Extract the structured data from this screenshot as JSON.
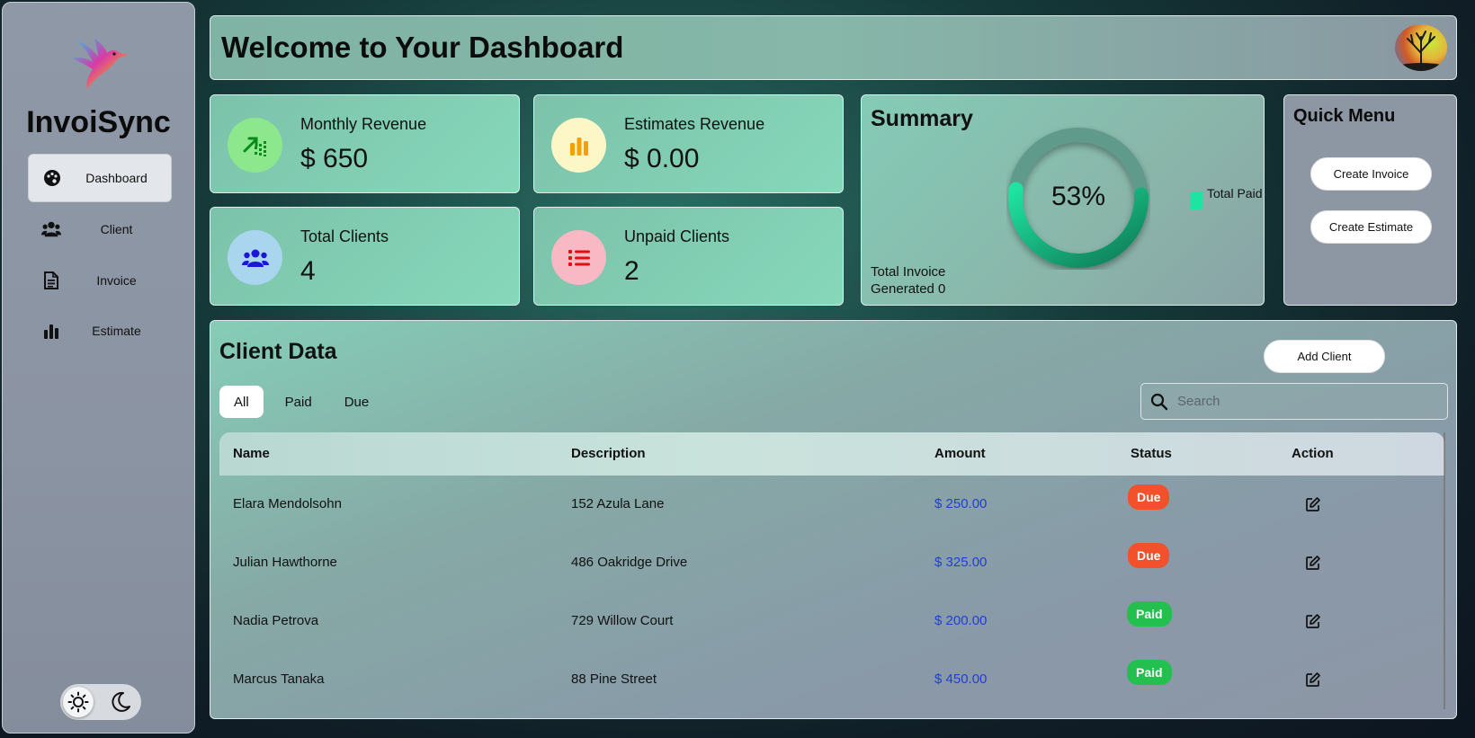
{
  "sidebar": {
    "brand": "InvoiSync",
    "items": [
      {
        "label": "Dashboard",
        "icon": "palette-icon"
      },
      {
        "label": "Client",
        "icon": "users-icon"
      },
      {
        "label": "Invoice",
        "icon": "document-icon"
      },
      {
        "label": "Estimate",
        "icon": "bar-chart-icon"
      }
    ]
  },
  "header": {
    "title": "Welcome to Your Dashboard"
  },
  "stats": [
    {
      "label": "Monthly Revenue",
      "value": "$ 650",
      "icon": "trend-up-icon",
      "circle_color": "#8de88d"
    },
    {
      "label": "Estimates Revenue",
      "value": "$ 0.00",
      "icon": "bar-chart-icon",
      "circle_color": "#fdf7c8"
    },
    {
      "label": "Total Clients",
      "value": "4",
      "icon": "users-icon",
      "circle_color": "#a9d6ee"
    },
    {
      "label": "Unpaid Clients",
      "value": "2",
      "icon": "list-icon",
      "circle_color": "#f9b9c4"
    }
  ],
  "summary": {
    "title": "Summary",
    "total_invoice_text": "Total Invoice Generated 0",
    "percent_text": "53%",
    "percent_value": 53,
    "legend": "Total Paid",
    "accent": "#1fe3a0"
  },
  "quick_menu": {
    "title": "Quick Menu",
    "create_invoice": "Create Invoice",
    "create_estimate": "Create Estimate"
  },
  "client_data": {
    "title": "Client Data",
    "add_client": "Add Client",
    "tabs": [
      "All",
      "Paid",
      "Due"
    ],
    "active_tab": "All",
    "search_placeholder": "Search",
    "columns": [
      "Name",
      "Description",
      "Amount",
      "Status",
      "Action"
    ],
    "rows": [
      {
        "name": "Elara Mendolsohn",
        "description": "152 Azula Lane",
        "amount": "$ 250.00",
        "status": "Due"
      },
      {
        "name": "Julian Hawthorne",
        "description": "486 Oakridge Drive",
        "amount": "$ 325.00",
        "status": "Due"
      },
      {
        "name": "Nadia Petrova",
        "description": "729 Willow Court",
        "amount": "$ 200.00",
        "status": "Paid"
      },
      {
        "name": "Marcus Tanaka",
        "description": "88 Pine Street",
        "amount": "$ 450.00",
        "status": "Paid"
      }
    ]
  },
  "colors": {
    "due": "#f2512b",
    "paid": "#23c04f",
    "amount": "#1f3fd6"
  }
}
